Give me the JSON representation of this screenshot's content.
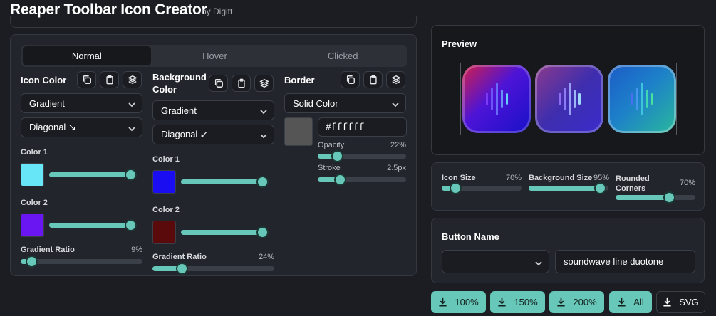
{
  "app": {
    "title": "Reaper Toolbar Icon Creator",
    "byline": "by Digitt"
  },
  "tabs": [
    "Normal",
    "Hover",
    "Clicked"
  ],
  "icon_color": {
    "label": "Icon Color",
    "fill_mode": "Gradient",
    "direction": "Diagonal ↘",
    "color1": {
      "label": "Color 1",
      "hex": "#66e6f7",
      "slider": 1.0
    },
    "color2": {
      "label": "Color 2",
      "hex": "#6a16f2",
      "slider": 1.0
    },
    "ratio": {
      "label": "Gradient Ratio",
      "value": "9%",
      "fraction": 0.09
    }
  },
  "background_color": {
    "label": "Background Color",
    "fill_mode": "Gradient",
    "direction": "Diagonal ↙",
    "color1": {
      "label": "Color 1",
      "hex": "#1b0df2",
      "slider": 1.0
    },
    "color2": {
      "label": "Color 2",
      "hex": "#5a0a0b",
      "slider": 1.0
    },
    "ratio": {
      "label": "Gradient Ratio",
      "value": "24%",
      "fraction": 0.24
    }
  },
  "border": {
    "label": "Border",
    "mode": "Solid Color",
    "swatch": "#555555",
    "hex": "#ffffff",
    "opacity": {
      "label": "Opacity",
      "value": "22%",
      "fraction": 0.22
    },
    "stroke": {
      "label": "Stroke",
      "value": "2.5px",
      "fraction": 0.25
    }
  },
  "preview": {
    "label": "Preview"
  },
  "sizes": {
    "icon_size": {
      "label": "Icon Size",
      "value": "70%",
      "fraction": 0.17
    },
    "background_size": {
      "label": "Background Size",
      "value": "95%",
      "fraction": 0.9
    },
    "rounded_corners": {
      "label": "Rounded Corners",
      "value": "70%",
      "fraction": 0.67
    }
  },
  "button_name": {
    "label": "Button Name",
    "select_value": "",
    "text_value": "soundwave line duotone"
  },
  "downloads": [
    "100%",
    "150%",
    "200%",
    "All",
    "SVG"
  ],
  "accent": "#67c7b8",
  "icons": {
    "copy": "copy-icon",
    "paste": "clipboard-icon",
    "layers": "layers-icon",
    "chevron": "chevron-down-icon",
    "download": "download-icon"
  }
}
